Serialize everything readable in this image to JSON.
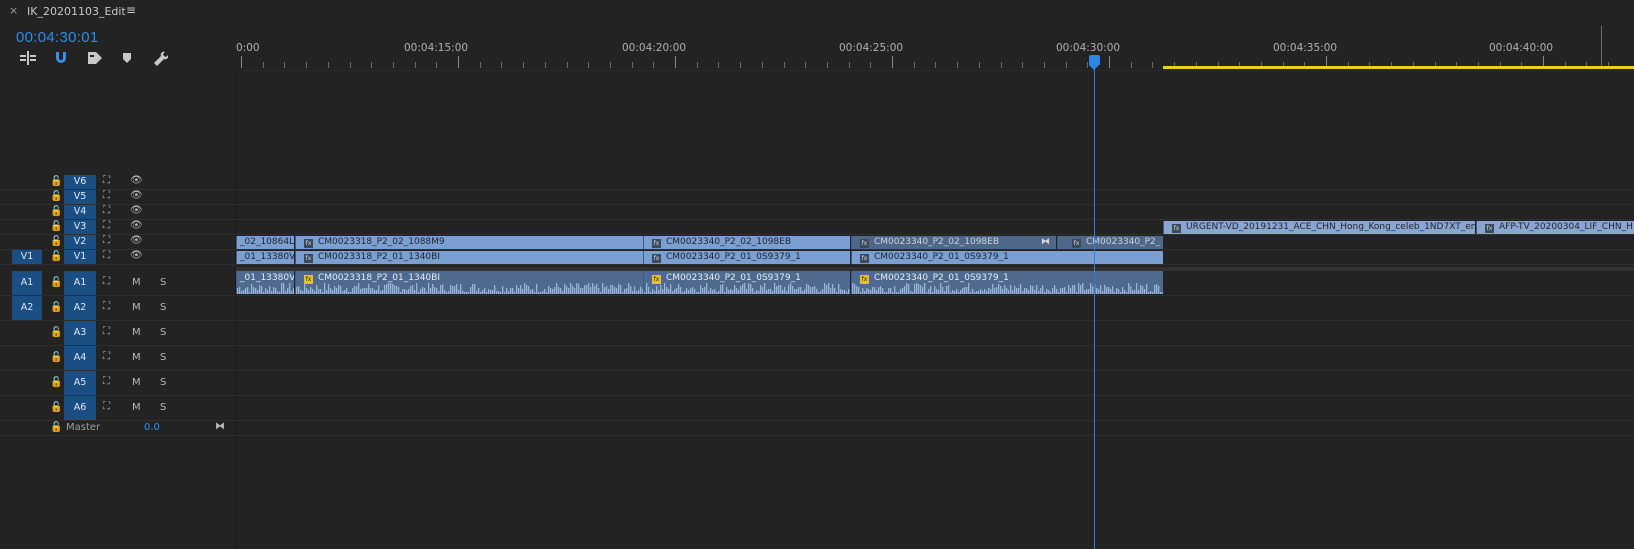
{
  "sequence": {
    "close_glyph": "×",
    "title": "IK_20201103_Edit",
    "menu_glyph": "≡",
    "timecode": "00:04:30:01"
  },
  "toolbar": {
    "tools": [
      {
        "name": "insert-icon",
        "glyph": "⇹"
      },
      {
        "name": "snap-icon",
        "glyph": "∩"
      },
      {
        "name": "linked-selection-icon",
        "glyph": "⧉"
      },
      {
        "name": "add-marker-icon",
        "glyph": "⬟"
      },
      {
        "name": "wrench-icon",
        "glyph": "🔧"
      }
    ]
  },
  "ruler": {
    "labels": [
      "0:00",
      "00:04:15:00",
      "00:04:20:00",
      "00:04:25:00",
      "00:04:30:00",
      "00:04:35:00",
      "00:04:40:00"
    ]
  },
  "tracks": {
    "video": [
      {
        "source": "",
        "target": "V6",
        "eye": "👁"
      },
      {
        "source": "",
        "target": "V5",
        "eye": "👁"
      },
      {
        "source": "",
        "target": "V4",
        "eye": "👁"
      },
      {
        "source": "",
        "target": "V3",
        "eye": "👁"
      },
      {
        "source": "",
        "target": "V2",
        "eye": "👁"
      },
      {
        "source": "V1",
        "target": "V1",
        "eye": "👁"
      }
    ],
    "audio": [
      {
        "source": "A1",
        "target": "A1",
        "m": "M",
        "s": "S"
      },
      {
        "source": "A2",
        "target": "A2",
        "m": "M",
        "s": "S"
      },
      {
        "source": "",
        "target": "A3",
        "m": "M",
        "s": "S"
      },
      {
        "source": "",
        "target": "A4",
        "m": "M",
        "s": "S"
      },
      {
        "source": "",
        "target": "A5",
        "m": "M",
        "s": "S"
      },
      {
        "source": "",
        "target": "A6",
        "m": "M",
        "s": "S"
      }
    ],
    "master": {
      "label": "Master",
      "value": "0.0",
      "glyph": "⧓"
    }
  },
  "clips": {
    "v3": [
      {
        "name": "URGENT-VD_20191231_ACE_CHN_Hong_Kong_celeb_1ND7XT_en."
      },
      {
        "name": "AFP-TV_20200304_LIF_CHN_H"
      }
    ],
    "v2": [
      {
        "name": "_02_10864L"
      },
      {
        "name": "CM0023318_P2_02_1088M9"
      },
      {
        "name": "CM0023340_P2_02_1098EB"
      },
      {
        "name": "CM0023340_P2_02_1098EB"
      },
      {
        "name": "CM0023340_P2_"
      }
    ],
    "v1": [
      {
        "name": "_01_13380V"
      },
      {
        "name": "CM0023318_P2_01_1340BI"
      },
      {
        "name": "CM0023340_P2_01_0S9379_1"
      },
      {
        "name": "CM0023340_P2_01_0S9379_1"
      }
    ],
    "a1": [
      {
        "name": "_01_13380V"
      },
      {
        "name": "CM0023318_P2_01_1340BI"
      },
      {
        "name": "CM0023340_P2_01_0S9379_1"
      },
      {
        "name": "CM0023340_P2_01_0S9379_1"
      }
    ]
  },
  "icons": {
    "lock": "🔓",
    "sync": "⛶",
    "fx": "fx",
    "transition": "⧓"
  },
  "colors": {
    "accent": "#2d8ceb",
    "track_target": "#1b4f84",
    "clip": "#7b9fd0",
    "work_area": "#e6d31e"
  }
}
